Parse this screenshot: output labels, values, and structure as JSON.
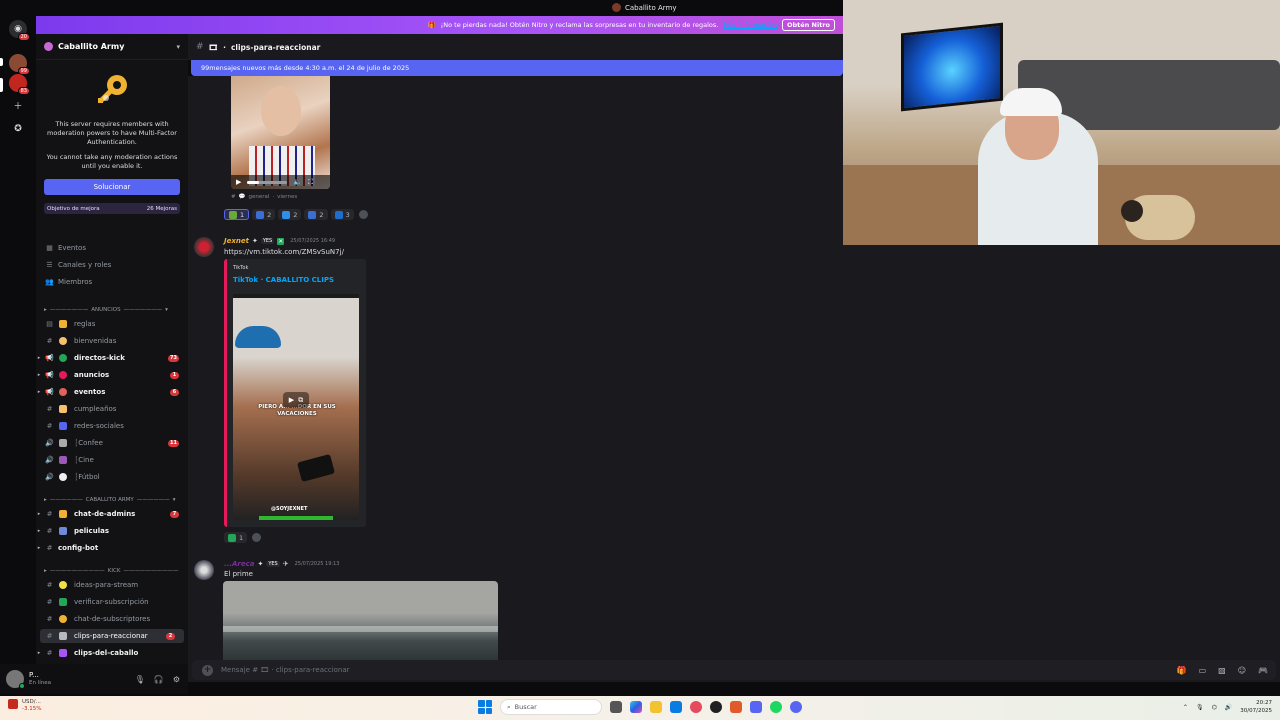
{
  "window": {
    "title": "Caballito Army"
  },
  "servers": [
    {
      "name": "Direct Messages",
      "badge": "20"
    },
    {
      "name": "Server 1",
      "badge": "99"
    },
    {
      "name": "Server 2",
      "badge": "83"
    },
    {
      "name": "Add a Server"
    },
    {
      "name": "Discover"
    }
  ],
  "nitro_banner": {
    "text": "¡No te pierdas nada! Obtén Nitro y reclama las sorpresas en tu inventario de regalos.",
    "link": "Más información",
    "button": "Obtén Nitro"
  },
  "sidebar": {
    "server_name": "Caballito Army",
    "mfa": {
      "line1": "This server requires members with moderation powers to have Multi-Factor Authentication.",
      "line2": "You cannot take any moderation actions until you enable it.",
      "button": "Solucionar"
    },
    "boost": {
      "label": "Objetivo de mejora",
      "count": "26 Mejoras"
    },
    "nav": [
      {
        "label": "Eventos",
        "icon": "calendar-icon"
      },
      {
        "label": "Canales y roles",
        "icon": "list-icon"
      },
      {
        "label": "Miembros",
        "icon": "members-icon"
      }
    ],
    "categories": {
      "anuncios": "ANUNCIOS",
      "caballito": "CABALLITO ARMY",
      "kick": "KICK"
    },
    "channels": [
      {
        "label": "reglas",
        "icon": "rules-icon",
        "unread": false,
        "badge": ""
      },
      {
        "label": "bienvenidas",
        "icon": "text-channel-icon",
        "unread": false,
        "badge": ""
      },
      {
        "label": "directos-kick",
        "icon": "announcement-icon",
        "unread": true,
        "badge": "73"
      },
      {
        "label": "anuncios",
        "icon": "announcement-icon",
        "unread": true,
        "badge": "1"
      },
      {
        "label": "eventos",
        "icon": "announcement-icon",
        "unread": true,
        "badge": "6"
      },
      {
        "label": "cumpleaños",
        "icon": "text-channel-icon",
        "unread": false,
        "badge": ""
      },
      {
        "label": "redes-sociales",
        "icon": "text-channel-icon",
        "unread": false,
        "badge": ""
      },
      {
        "label": "┆Confee",
        "icon": "voice-icon",
        "unread": false,
        "badge": "11"
      },
      {
        "label": "┆Cine",
        "icon": "voice-icon",
        "unread": false,
        "badge": ""
      },
      {
        "label": "┆Fútbol",
        "icon": "voice-icon",
        "unread": false,
        "badge": ""
      },
      {
        "label": "chat-de-admins",
        "icon": "text-channel-icon",
        "unread": true,
        "badge": "7"
      },
      {
        "label": "peliculas",
        "icon": "text-channel-icon",
        "unread": true,
        "badge": ""
      },
      {
        "label": "config-bot",
        "icon": "text-channel-icon",
        "unread": true,
        "badge": ""
      },
      {
        "label": "ideas-para-stream",
        "icon": "text-channel-icon",
        "unread": false,
        "badge": ""
      },
      {
        "label": "verificar-subscripción",
        "icon": "text-channel-icon",
        "unread": false,
        "badge": ""
      },
      {
        "label": "chat-de-subscriptores",
        "icon": "text-channel-icon",
        "unread": false,
        "badge": ""
      },
      {
        "label": "clips-para-reaccionar",
        "icon": "text-channel-icon",
        "unread": false,
        "badge": "2"
      },
      {
        "label": "clips-del-caballo",
        "icon": "text-channel-icon",
        "unread": true,
        "badge": ""
      }
    ]
  },
  "user": {
    "name": "P...",
    "status": "En línea"
  },
  "chat": {
    "channel": "clips-para-reaccionar",
    "new_messages": "99mensajes nuevos más desde 4:30 a.m. el 24 de julio de 2025",
    "msg0": {
      "meta_channel": "general",
      "meta_day": "viernes",
      "reactions": [
        "1",
        "2",
        "2",
        "2",
        "3"
      ]
    },
    "msg1": {
      "author": "Jexnet",
      "tag": "YES",
      "time": "25/07/2025 16:49",
      "link": "https://vm.tiktok.com/ZMSvSuN7j/",
      "embed_provider": "TikTok",
      "embed_title": "TikTok · CABALLITO CLIPS",
      "video_caption": "PIERO A... ...DOR EN SUS VACACIONES",
      "video_handle": "@SOYJEXNET",
      "reactions": [
        "1"
      ]
    },
    "msg2": {
      "author": "...Areca",
      "tag": "YES",
      "time": "25/07/2025 19:13",
      "body": "El prime"
    },
    "composer_placeholder": "Mensaje #",
    "composer_channel": "clips-para-reaccionar"
  },
  "taskbar": {
    "ticker": "USD/...",
    "ticker_change": "-3.15%",
    "search": "Buscar",
    "time": "20:27",
    "date": "30/07/2025"
  }
}
